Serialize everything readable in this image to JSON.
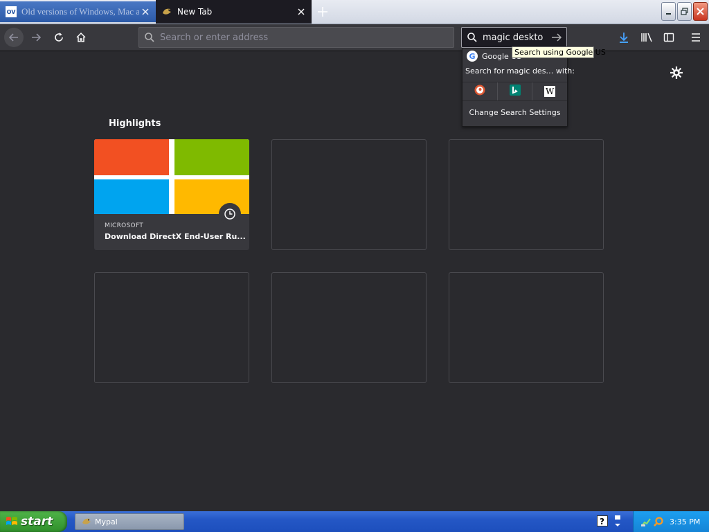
{
  "tabs": [
    {
      "title": "Old versions of Windows, Mac and",
      "favicon": "oldversion-icon",
      "active": false
    },
    {
      "title": "New Tab",
      "favicon": "mypal-icon",
      "active": true
    }
  ],
  "favicon_text": "OV",
  "toolbar": {
    "url_placeholder": "Search or enter address",
    "search_value": "magic deskto"
  },
  "search_popup": {
    "engine_name": "Google US",
    "search_with_label": "Search for magic des…  with:",
    "engines": [
      "duckduckgo-icon",
      "bing-icon",
      "wikipedia-icon"
    ],
    "wiki_letter": "W",
    "change_settings": "Change Search Settings",
    "tooltip": "Search using Google US"
  },
  "main": {
    "highlights_title": "Highlights",
    "cards": [
      {
        "source": "MICROSOFT",
        "title": "Download DirectX End-User Ru..."
      }
    ]
  },
  "taskbar": {
    "start_label": "start",
    "task_label": "Mypal",
    "time": "3:35 PM"
  },
  "colors": {
    "background": "#2a2a2e",
    "toolbar": "#38383d",
    "accent_download": "#45a1ff",
    "ms_red": "#f25022",
    "ms_green": "#7fba00",
    "ms_blue": "#00a4ef",
    "ms_yellow": "#ffb900"
  }
}
